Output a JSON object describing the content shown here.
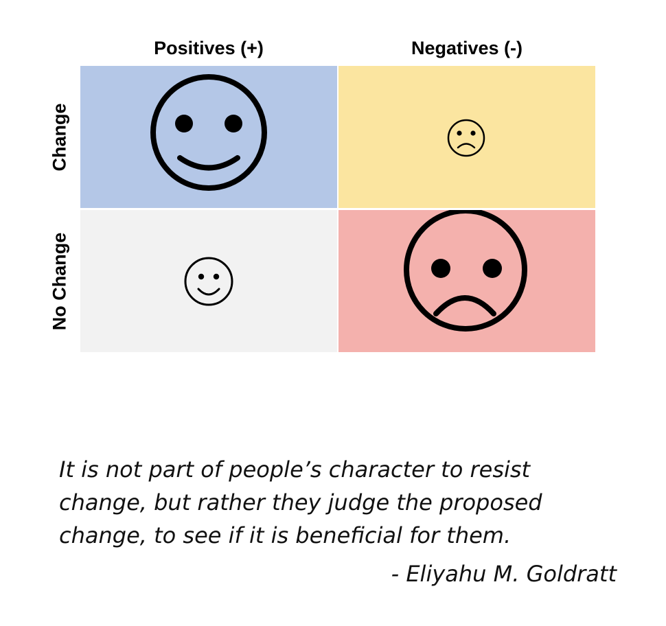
{
  "matrix": {
    "columns": [
      "Positives (+)",
      "Negatives (-)"
    ],
    "rows": [
      "Change",
      "No Change"
    ],
    "quadrants": {
      "change_positives": {
        "face": "large-smiley-face-icon",
        "color": "#b4c7e7"
      },
      "change_negatives": {
        "face": "small-frowning-face-icon",
        "color": "#fbe5a0"
      },
      "nochange_positives": {
        "face": "small-smiley-face-icon",
        "color": "#f2f2f2"
      },
      "nochange_negatives": {
        "face": "large-frowning-face-icon",
        "color": "#f4b1ad"
      }
    }
  },
  "quote": {
    "text": "It is not part of people’s character to resist change, but rather they judge the proposed change, to see if it is beneficial for them.",
    "author": "- Eliyahu M. Goldratt"
  }
}
